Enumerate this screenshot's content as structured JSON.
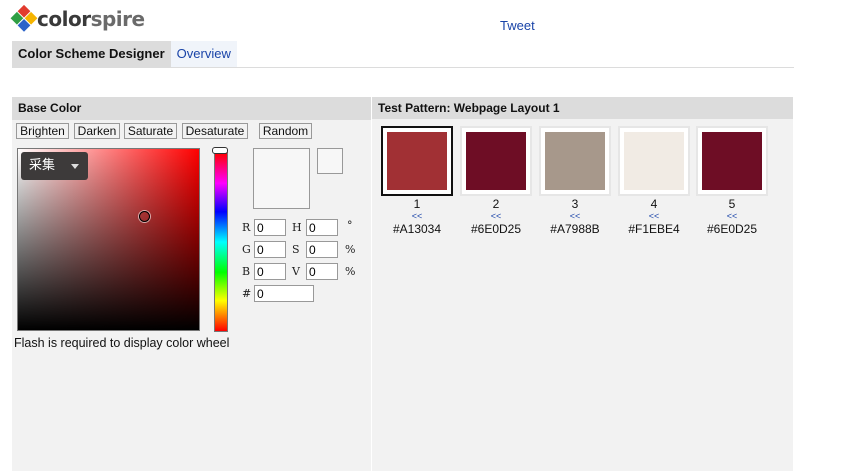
{
  "logo": {
    "part1": "color",
    "part2": "spire",
    "colors": [
      "#e23b2e",
      "#f5b400",
      "#2f9e44",
      "#2b63c9"
    ]
  },
  "header": {
    "tweet": "Tweet"
  },
  "tabs": [
    {
      "label": "Color Scheme Designer",
      "active": true
    },
    {
      "label": "Overview",
      "active": false
    }
  ],
  "base_color": {
    "title": "Base Color",
    "buttons": {
      "brighten": "Brighten",
      "darken": "Darken",
      "saturate": "Saturate",
      "desaturate": "Desaturate",
      "random": "Random"
    },
    "picker_dropdown": "采集",
    "fields": {
      "r": {
        "label": "R",
        "value": "0"
      },
      "g": {
        "label": "G",
        "value": "0"
      },
      "b": {
        "label": "B",
        "value": "0"
      },
      "h": {
        "label": "H",
        "value": "0",
        "unit": "°"
      },
      "s": {
        "label": "S",
        "value": "0",
        "unit": "%"
      },
      "v": {
        "label": "V",
        "value": "0",
        "unit": "%"
      },
      "hex": {
        "label": "#",
        "value": "0"
      }
    },
    "flash_message": "Flash is required to display color wheel"
  },
  "test_pattern": {
    "title": "Test Pattern: Webpage Layout 1",
    "arrows": "<<",
    "swatches": [
      {
        "num": "1",
        "hex": "#A13034",
        "color": "#A13034"
      },
      {
        "num": "2",
        "hex": "#6E0D25",
        "color": "#6E0D25"
      },
      {
        "num": "3",
        "hex": "#A7988B",
        "color": "#A7988B"
      },
      {
        "num": "4",
        "hex": "#F1EBE4",
        "color": "#F1EBE4"
      },
      {
        "num": "5",
        "hex": "#6E0D25",
        "color": "#6E0D25"
      }
    ]
  }
}
